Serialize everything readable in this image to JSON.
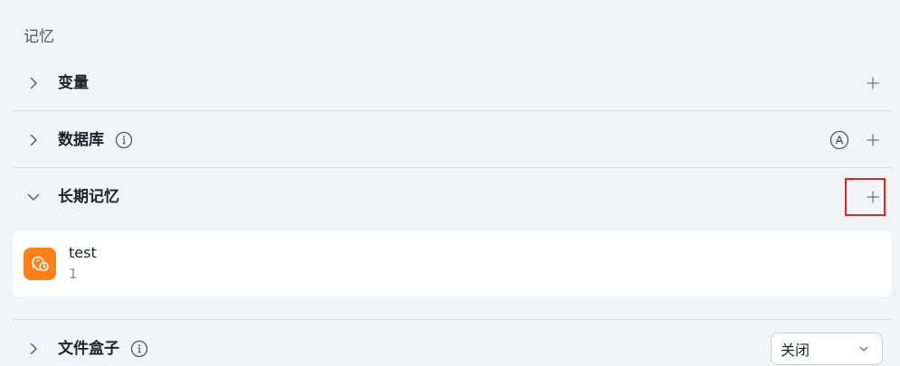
{
  "section": {
    "title": "记忆"
  },
  "rows": {
    "variables": {
      "label": "变量"
    },
    "database": {
      "label": "数据库"
    },
    "long_term_memory": {
      "label": "长期记忆"
    },
    "file_box": {
      "label": "文件盒子"
    }
  },
  "memory_items": [
    {
      "name": "test",
      "subtitle": "1",
      "icon": "memory-icon"
    }
  ],
  "file_box_select": {
    "value": "关闭"
  },
  "colors": {
    "accent_orange": "#ff811a",
    "highlight_red": "#e0252b",
    "background": "#f2f3f7"
  }
}
